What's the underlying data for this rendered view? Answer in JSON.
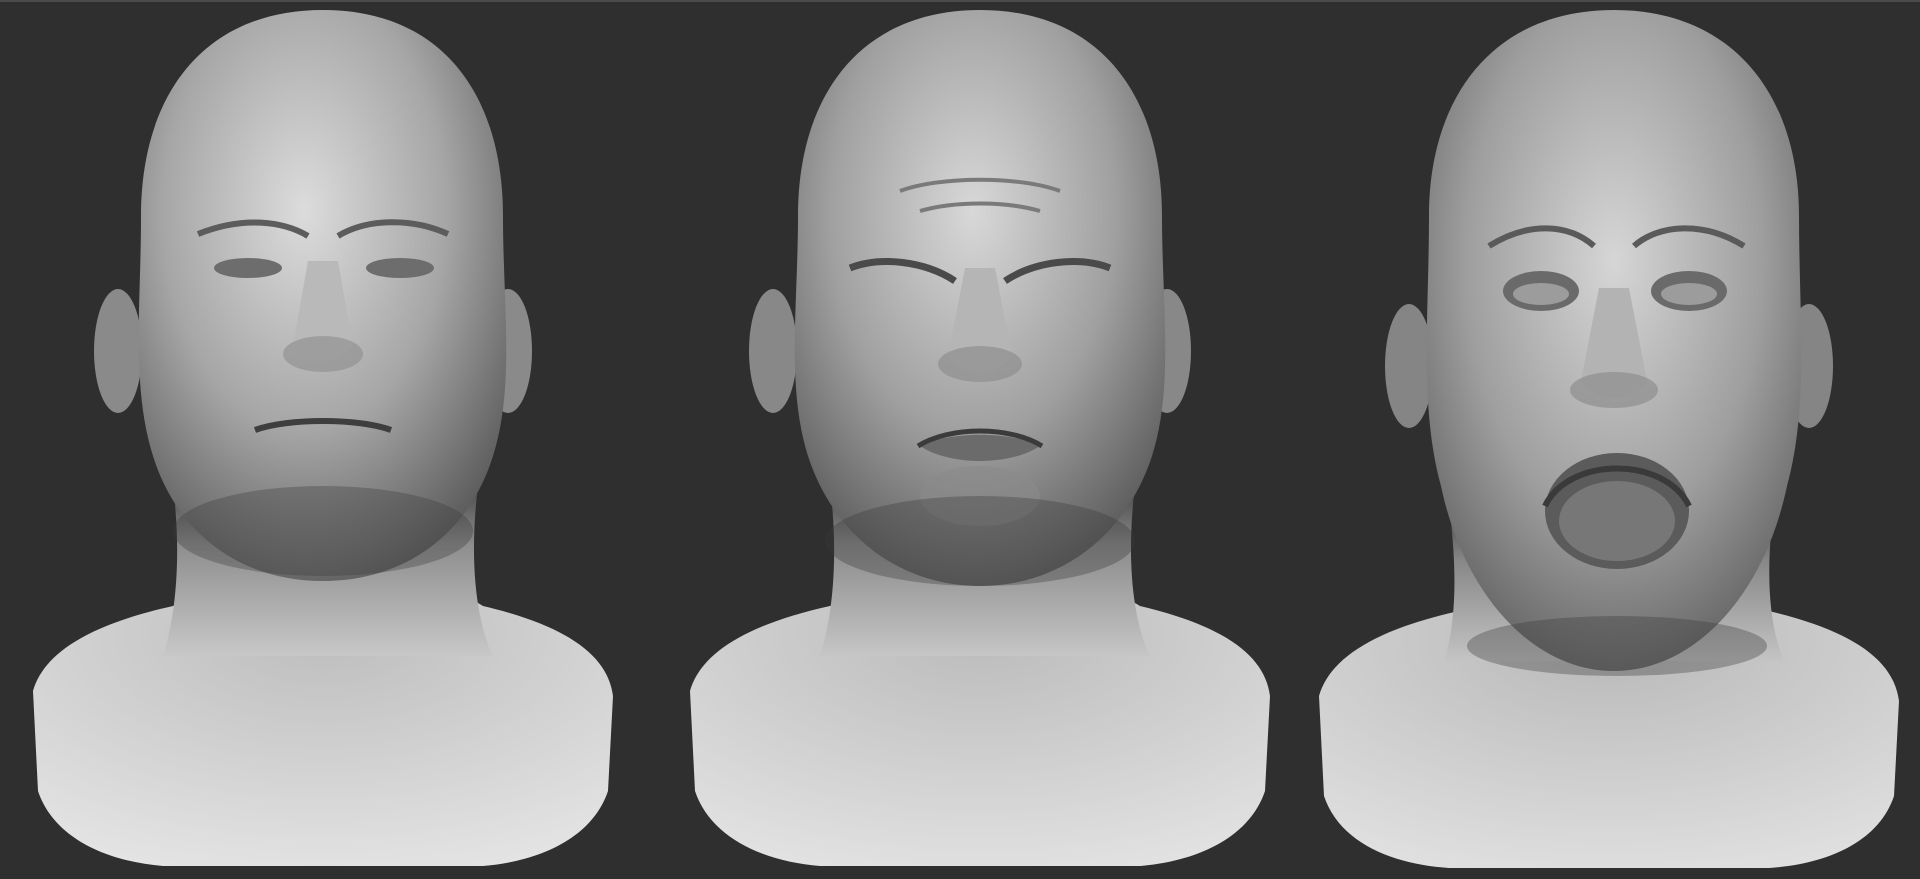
{
  "viewport": {
    "background_color": "#2f2f2f",
    "edge_color": "#4b4b4b"
  },
  "sculpts": [
    {
      "expression": "neutral",
      "shade_light": "#d8d8d8",
      "shade_mid": "#9a9a9a",
      "shade_dark": "#3d3d3d"
    },
    {
      "expression": "squint-frown",
      "shade_light": "#d6d6d6",
      "shade_mid": "#979797",
      "shade_dark": "#3b3b3b"
    },
    {
      "expression": "scream",
      "shade_light": "#d4d4d4",
      "shade_mid": "#959595",
      "shade_dark": "#3a3a3a"
    }
  ]
}
